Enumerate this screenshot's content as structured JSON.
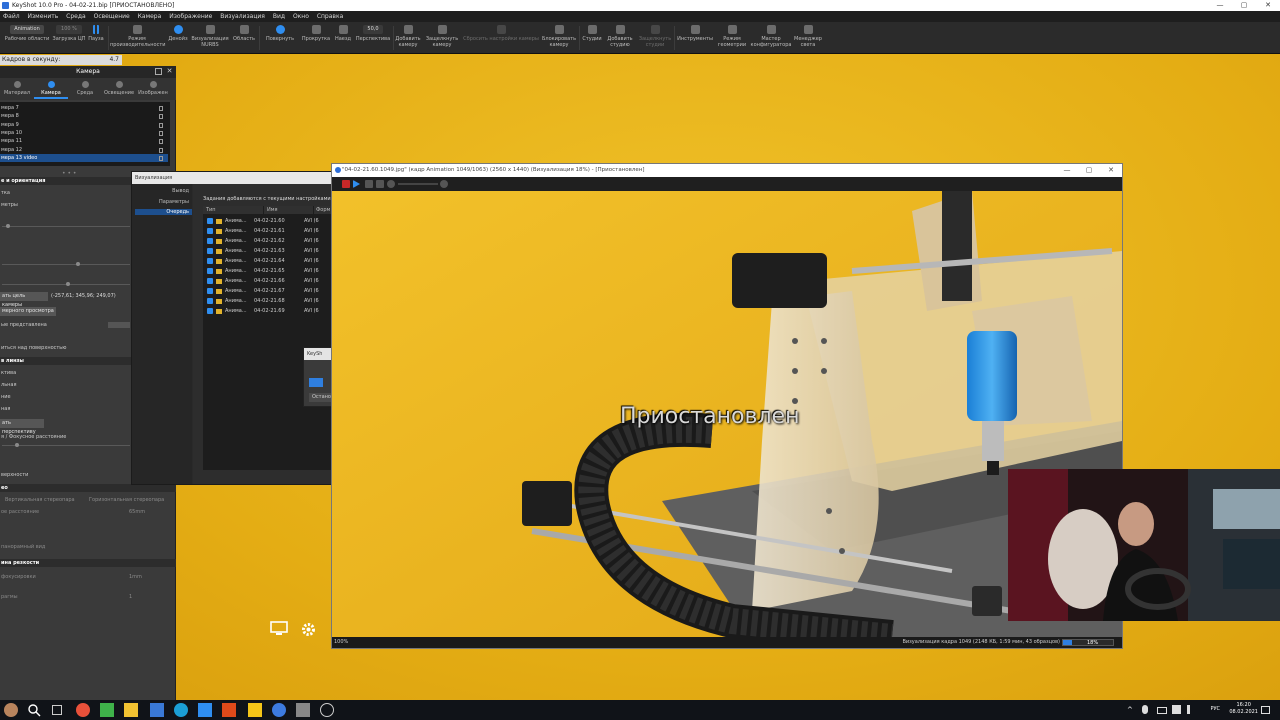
{
  "window": {
    "title": "KeyShot 10.0 Pro - 04-02-21.bip [ПРИОСТАНОВЛЕНО]",
    "min": "—",
    "max": "▢",
    "close": "✕"
  },
  "menu": [
    "Файл",
    "Изменить",
    "Среда",
    "Освещение",
    "Камера",
    "Изображение",
    "Визуализация",
    "Вид",
    "Окно",
    "Справка"
  ],
  "toolbar": {
    "workspace_value": "Animation",
    "workspace_label": "Рабочие области",
    "cpu_value": "100 %",
    "cpu_label": "Загрузка ЦП",
    "pause_label": "Пауза",
    "perf_label": "Режим производительности",
    "denoise_label": "Денойз",
    "nurbs_label": "Визуализация NURBS",
    "region_label": "Область",
    "rotate_label": "Повернуть",
    "scroll_label": "Прокрутка",
    "dolly_label": "Наезд",
    "perspective_label": "Перспектива",
    "fov_value": "50,0",
    "add_camera_label": "Добавить камеру",
    "lock_camera_label": "Защелкнуть камеру",
    "reset_camera_label": "Сбросить настройки камеры",
    "lock_cam2_label": "Блокировать камеру",
    "studios_label": "Студии",
    "add_studio_label": "Добавить студию",
    "lock_studio_label": "Защелкнуть студии",
    "tools_label": "Инструменты",
    "geometry_label": "Режим геометрии",
    "config_label": "Мастер конфигуратора",
    "light_label": "Менеджер света"
  },
  "fps": {
    "label": "Кадров в секунду:",
    "value": "4.7"
  },
  "camera_panel": {
    "title": "Камера",
    "tabs": [
      "Материал",
      "Камера",
      "Среда",
      "Освещение",
      "Изображен"
    ],
    "active_tab": "Камера",
    "cameras": [
      "мера 7",
      "мера 8",
      "мера 9",
      "мера 10",
      "мера 11",
      "мера 12",
      "мера 13 video"
    ],
    "selected_camera": "мера 13 video",
    "section_orientation": "е и ориентация",
    "label_tka": "тка",
    "label_metry": "метры",
    "target_button": "ать цель камеры",
    "target_coords": "(-257,61; 345,96; 249,07)",
    "preview_button": "мерного просмотра",
    "view_label": "ые представлена",
    "surface_label": "иться над поверхностью",
    "lens_section": "в линзы",
    "lens_opts": [
      "ктива",
      "льная",
      "ние",
      "ная"
    ],
    "persp_button": "ать перспективу",
    "focal_label": "я / Фокусное расстояние",
    "proj_label": "верхности",
    "stereo_section": "ео",
    "stereo_v": "Вертикальная стереопара",
    "stereo_h": "Горизонтальная стереопара",
    "ipd_label": "ое расстояние",
    "ipd_value": "65mm",
    "pano_label": "панорамный вид",
    "dof_section": "ина резкости",
    "focus_label": "фокусировки",
    "focus_value": "1mm",
    "aperture_label": "рагмы",
    "aperture_value": "1"
  },
  "queue_window": {
    "title": "Визуализация",
    "side": [
      "Вывод",
      "Параметры",
      "Очередь"
    ],
    "active_side": "Очередь",
    "hint": "Задания добавляются с текущими настройками, у",
    "columns": [
      "Тип",
      "Имя",
      "Форм"
    ],
    "rows": [
      {
        "type": "Анима...",
        "name": "04-02-21.60",
        "fmt": "AVI (6"
      },
      {
        "type": "Анима...",
        "name": "04-02-21.61",
        "fmt": "AVI (6"
      },
      {
        "type": "Анима...",
        "name": "04-02-21.62",
        "fmt": "AVI (6"
      },
      {
        "type": "Анима...",
        "name": "04-02-21.63",
        "fmt": "AVI (6"
      },
      {
        "type": "Анима...",
        "name": "04-02-21.64",
        "fmt": "AVI (6"
      },
      {
        "type": "Анима...",
        "name": "04-02-21.65",
        "fmt": "AVI (6"
      },
      {
        "type": "Анима...",
        "name": "04-02-21.66",
        "fmt": "AVI (6"
      },
      {
        "type": "Анима...",
        "name": "04-02-21.67",
        "fmt": "AVI (6"
      },
      {
        "type": "Анима...",
        "name": "04-02-21.68",
        "fmt": "AVI (6"
      },
      {
        "type": "Анима...",
        "name": "04-02-21.69",
        "fmt": "AVI (6"
      }
    ]
  },
  "small_dialog": {
    "title": "KeySh",
    "stop_button": "Остано"
  },
  "render_window": {
    "title": "\"04-02-21.60.1049.jpg\" (кадр Animation 1049/1063) (2560 x 1440) (Визуализация 18%) - [Приостановлен]",
    "paused_overlay": "Приостановлен",
    "zoom_pct": "100%",
    "status": "Визуализация кадра 1049 (2148 КБ, 1:59 мин, 43 образцов)",
    "progress_text": "18%",
    "progress": 18
  },
  "taskbar": {
    "lang": "РУС",
    "time": "16:20",
    "date": "08.02.2021"
  },
  "colors": {
    "accent": "#2f8ef0",
    "background": "#e8b31a",
    "panel": "#3a3a3a"
  }
}
